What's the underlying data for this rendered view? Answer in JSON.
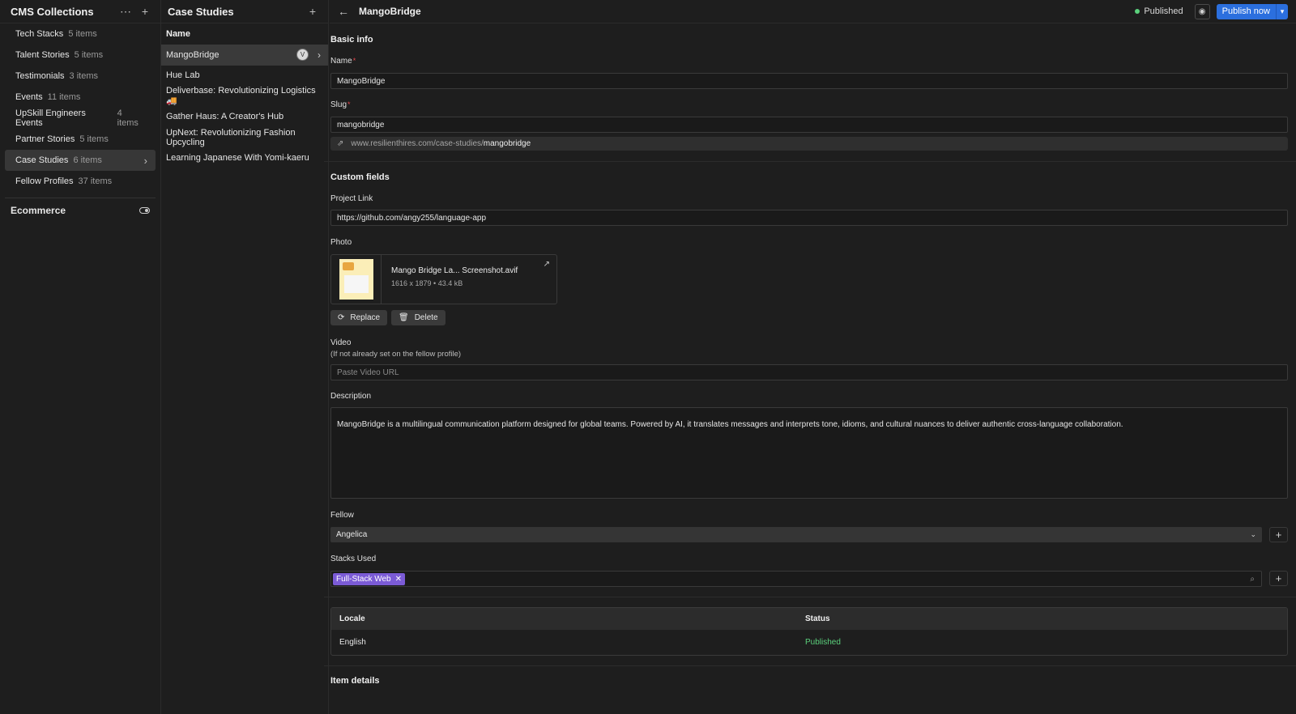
{
  "collections_panel": {
    "title": "CMS Collections",
    "items": [
      {
        "name": "Tech Stacks",
        "count": "5 items"
      },
      {
        "name": "Talent Stories",
        "count": "5 items"
      },
      {
        "name": "Testimonials",
        "count": "3 items"
      },
      {
        "name": "Events",
        "count": "11 items"
      },
      {
        "name": "UpSkill Engineers Events",
        "count": "4 items"
      },
      {
        "name": "Partner Stories",
        "count": "5 items"
      },
      {
        "name": "Case Studies",
        "count": "6 items"
      },
      {
        "name": "Fellow Profiles",
        "count": "37 items"
      }
    ],
    "active_index": 6,
    "ecommerce_label": "Ecommerce"
  },
  "items_panel": {
    "title": "Case Studies",
    "column_header": "Name",
    "rows": [
      "MangoBridge",
      "Hue Lab",
      "Deliverbase: Revolutionizing Logistics 🚚",
      "Gather Haus: A Creator's Hub",
      "UpNext: Revolutionizing Fashion Upcycling",
      "Learning Japanese With Yomi-kaeru"
    ],
    "active_index": 0
  },
  "detail": {
    "title": "MangoBridge",
    "status": "Published",
    "publish_label": "Publish now",
    "basic_info": {
      "section_title": "Basic info",
      "name_label": "Name",
      "name_value": "MangoBridge",
      "slug_label": "Slug",
      "slug_value": "mangobridge",
      "slug_url_prefix": "www.resilienthires.com/case-studies/",
      "slug_url_slug": "mangobridge"
    },
    "custom_fields": {
      "section_title": "Custom fields",
      "project_link_label": "Project Link",
      "project_link_value": "https://github.com/angy255/language-app",
      "photo_label": "Photo",
      "photo_name": "Mango Bridge La... Screenshot.avif",
      "photo_meta": "1616 x 1879 • 43.4 kB",
      "replace_label": "Replace",
      "delete_label": "Delete",
      "video_label": "Video",
      "video_hint": "(If not already set on the fellow profile)",
      "video_placeholder": "Paste Video URL",
      "description_label": "Description",
      "description_value": "MangoBridge is a multilingual communication platform designed for global teams. Powered by AI, it translates messages and interprets tone, idioms, and cultural nuances to deliver authentic cross-language collaboration.",
      "fellow_label": "Fellow",
      "fellow_value": "Angelica",
      "stacks_label": "Stacks Used",
      "stacks_tags": [
        "Full-Stack Web"
      ]
    },
    "locale_table": {
      "headers": [
        "Locale",
        "Status"
      ],
      "rows": [
        {
          "locale": "English",
          "status": "Published"
        }
      ]
    },
    "item_details_title": "Item details"
  },
  "colors": {
    "accent_blue": "#2b6fde",
    "published_green": "#5bd17c",
    "tag_purple": "#7b5bd6",
    "required_red": "#e5484d"
  }
}
